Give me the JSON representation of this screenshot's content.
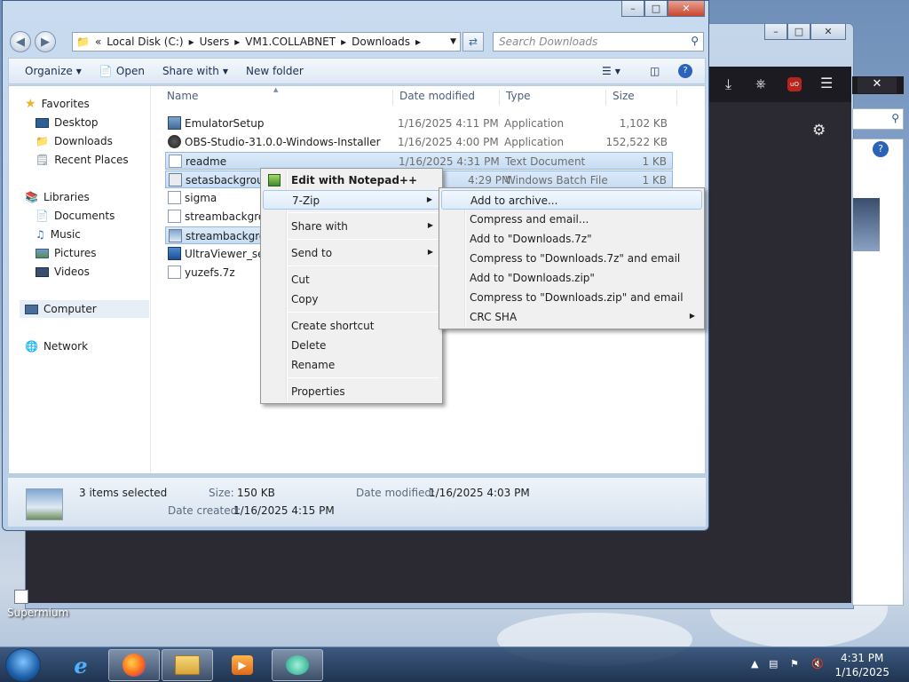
{
  "explorer": {
    "breadcrumb": [
      "Local Disk (C:)",
      "Users",
      "VM1.COLLABNET",
      "Downloads"
    ],
    "search_placeholder": "Search Downloads",
    "toolbar": {
      "organize": "Organize",
      "open": "Open",
      "share_with": "Share with",
      "new_folder": "New folder"
    },
    "sidebar": {
      "favorites": "Favorites",
      "desktop": "Desktop",
      "downloads": "Downloads",
      "recent_places": "Recent Places",
      "libraries": "Libraries",
      "documents": "Documents",
      "music": "Music",
      "pictures": "Pictures",
      "videos": "Videos",
      "computer": "Computer",
      "network": "Network"
    },
    "columns": {
      "name": "Name",
      "date_modified": "Date modified",
      "type": "Type",
      "size": "Size"
    },
    "files": [
      {
        "name": "EmulatorSetup",
        "date": "1/16/2025 4:11 PM",
        "type": "Application",
        "size": "1,102 KB",
        "selected": false
      },
      {
        "name": "OBS-Studio-31.0.0-Windows-Installer",
        "date": "1/16/2025 4:00 PM",
        "type": "Application",
        "size": "152,522 KB",
        "selected": false
      },
      {
        "name": "readme",
        "date": "1/16/2025 4:31 PM",
        "type": "Text Document",
        "size": "1 KB",
        "selected": true
      },
      {
        "name": "setasbackground",
        "date": "4:29 PM",
        "type": "Windows Batch File",
        "size": "1 KB",
        "selected": true
      },
      {
        "name": "sigma",
        "date": "",
        "type": "",
        "size": "",
        "selected": false
      },
      {
        "name": "streambackgrou",
        "date": "",
        "type": "",
        "size": "",
        "selected": false
      },
      {
        "name": "streambackgrou",
        "date": "",
        "type": "",
        "size": "",
        "selected": true
      },
      {
        "name": "UltraViewer_setu",
        "date": "",
        "type": "",
        "size": "",
        "selected": false
      },
      {
        "name": "yuzefs.7z",
        "date": "",
        "type": "",
        "size": "",
        "selected": false
      }
    ],
    "details": {
      "selected_count": "3 items selected",
      "size_label": "Size:",
      "size_value": "150 KB",
      "date_modified_label": "Date modified:",
      "date_modified_value": "1/16/2025 4:03 PM",
      "date_created_label": "Date created:",
      "date_created_value": "1/16/2025 4:15 PM"
    }
  },
  "context_menu": {
    "items": [
      {
        "label": "Edit with Notepad++",
        "bold": true
      },
      {
        "label": "7-Zip",
        "submenu": true,
        "highlighted": true
      },
      {
        "label": "Share with",
        "submenu": true
      },
      {
        "label": "Send to",
        "submenu": true
      },
      {
        "label": "Cut"
      },
      {
        "label": "Copy"
      },
      {
        "label": "Create shortcut"
      },
      {
        "label": "Delete"
      },
      {
        "label": "Rename"
      },
      {
        "label": "Properties"
      }
    ]
  },
  "submenu_7zip": {
    "items": [
      {
        "label": "Add to archive...",
        "highlighted": true
      },
      {
        "label": "Compress and email..."
      },
      {
        "label": "Add to \"Downloads.7z\""
      },
      {
        "label": "Compress to \"Downloads.7z\" and email"
      },
      {
        "label": "Add to \"Downloads.zip\""
      },
      {
        "label": "Compress to \"Downloads.zip\" and email"
      },
      {
        "label": "CRC SHA",
        "submenu": true
      }
    ]
  },
  "desktop": {
    "icon_label": "Supermium"
  },
  "taskbar": {
    "time": "4:31 PM",
    "date": "1/16/2025"
  },
  "colors": {
    "selection": "#cce0f5",
    "menu_bg": "#f0f0f0",
    "browser_dark": "#2b2a33"
  }
}
